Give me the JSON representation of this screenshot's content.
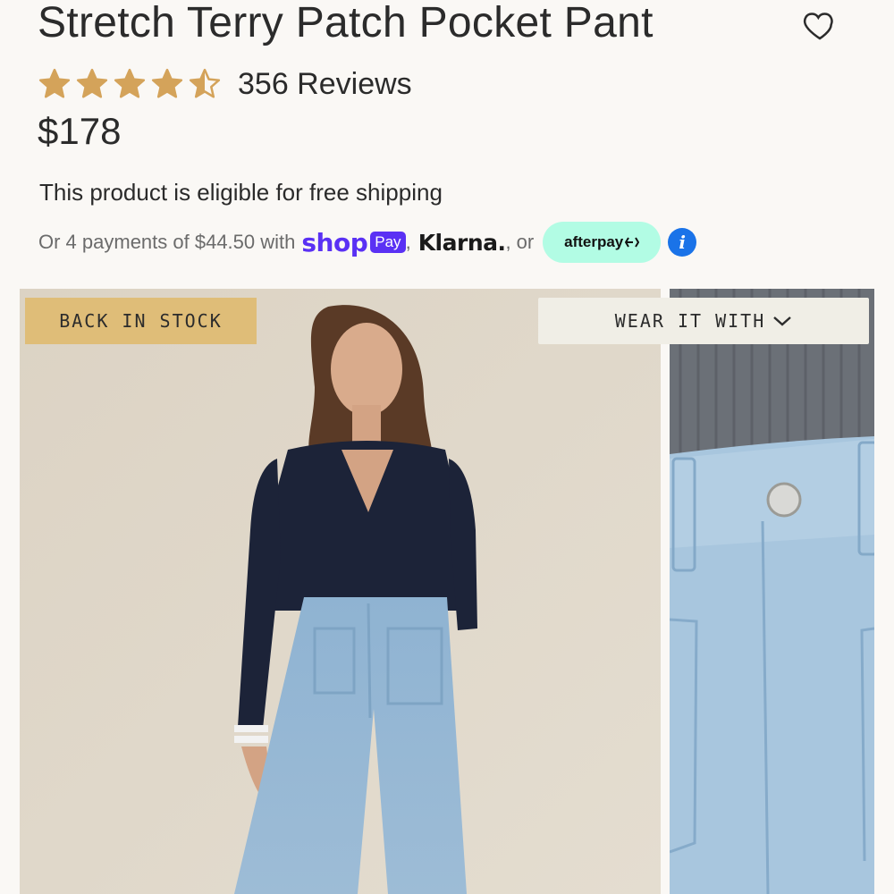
{
  "product": {
    "title": "Stretch Terry Patch Pocket Pant",
    "rating_value": 4.5,
    "rating_max": 5,
    "reviews_label": "356 Reviews",
    "price": "$178",
    "shipping_text": "This product is eligible for free shipping"
  },
  "payments": {
    "prefix": "Or 4 payments of $44.50 with",
    "shop_word": "shop",
    "shop_pay_pill": "Pay",
    "comma": ",",
    "klarna": "Klarna.",
    "klarna_comma": ",",
    "or": "or",
    "afterpay": "afterpay",
    "info_glyph": "i"
  },
  "gallery": {
    "badge": "BACK IN STOCK",
    "wear_it_with": "WEAR IT WITH"
  },
  "colors": {
    "star": "#d4a35a",
    "shop_purple": "#5a31f4",
    "afterpay_mint": "#b2fce4",
    "info_blue": "#1a73e8",
    "badge_gold": "#dfbd78"
  },
  "icons": {
    "favorite": "heart-outline-icon",
    "star": "star-icon",
    "info": "info-icon",
    "chevron": "chevron-down-icon"
  }
}
